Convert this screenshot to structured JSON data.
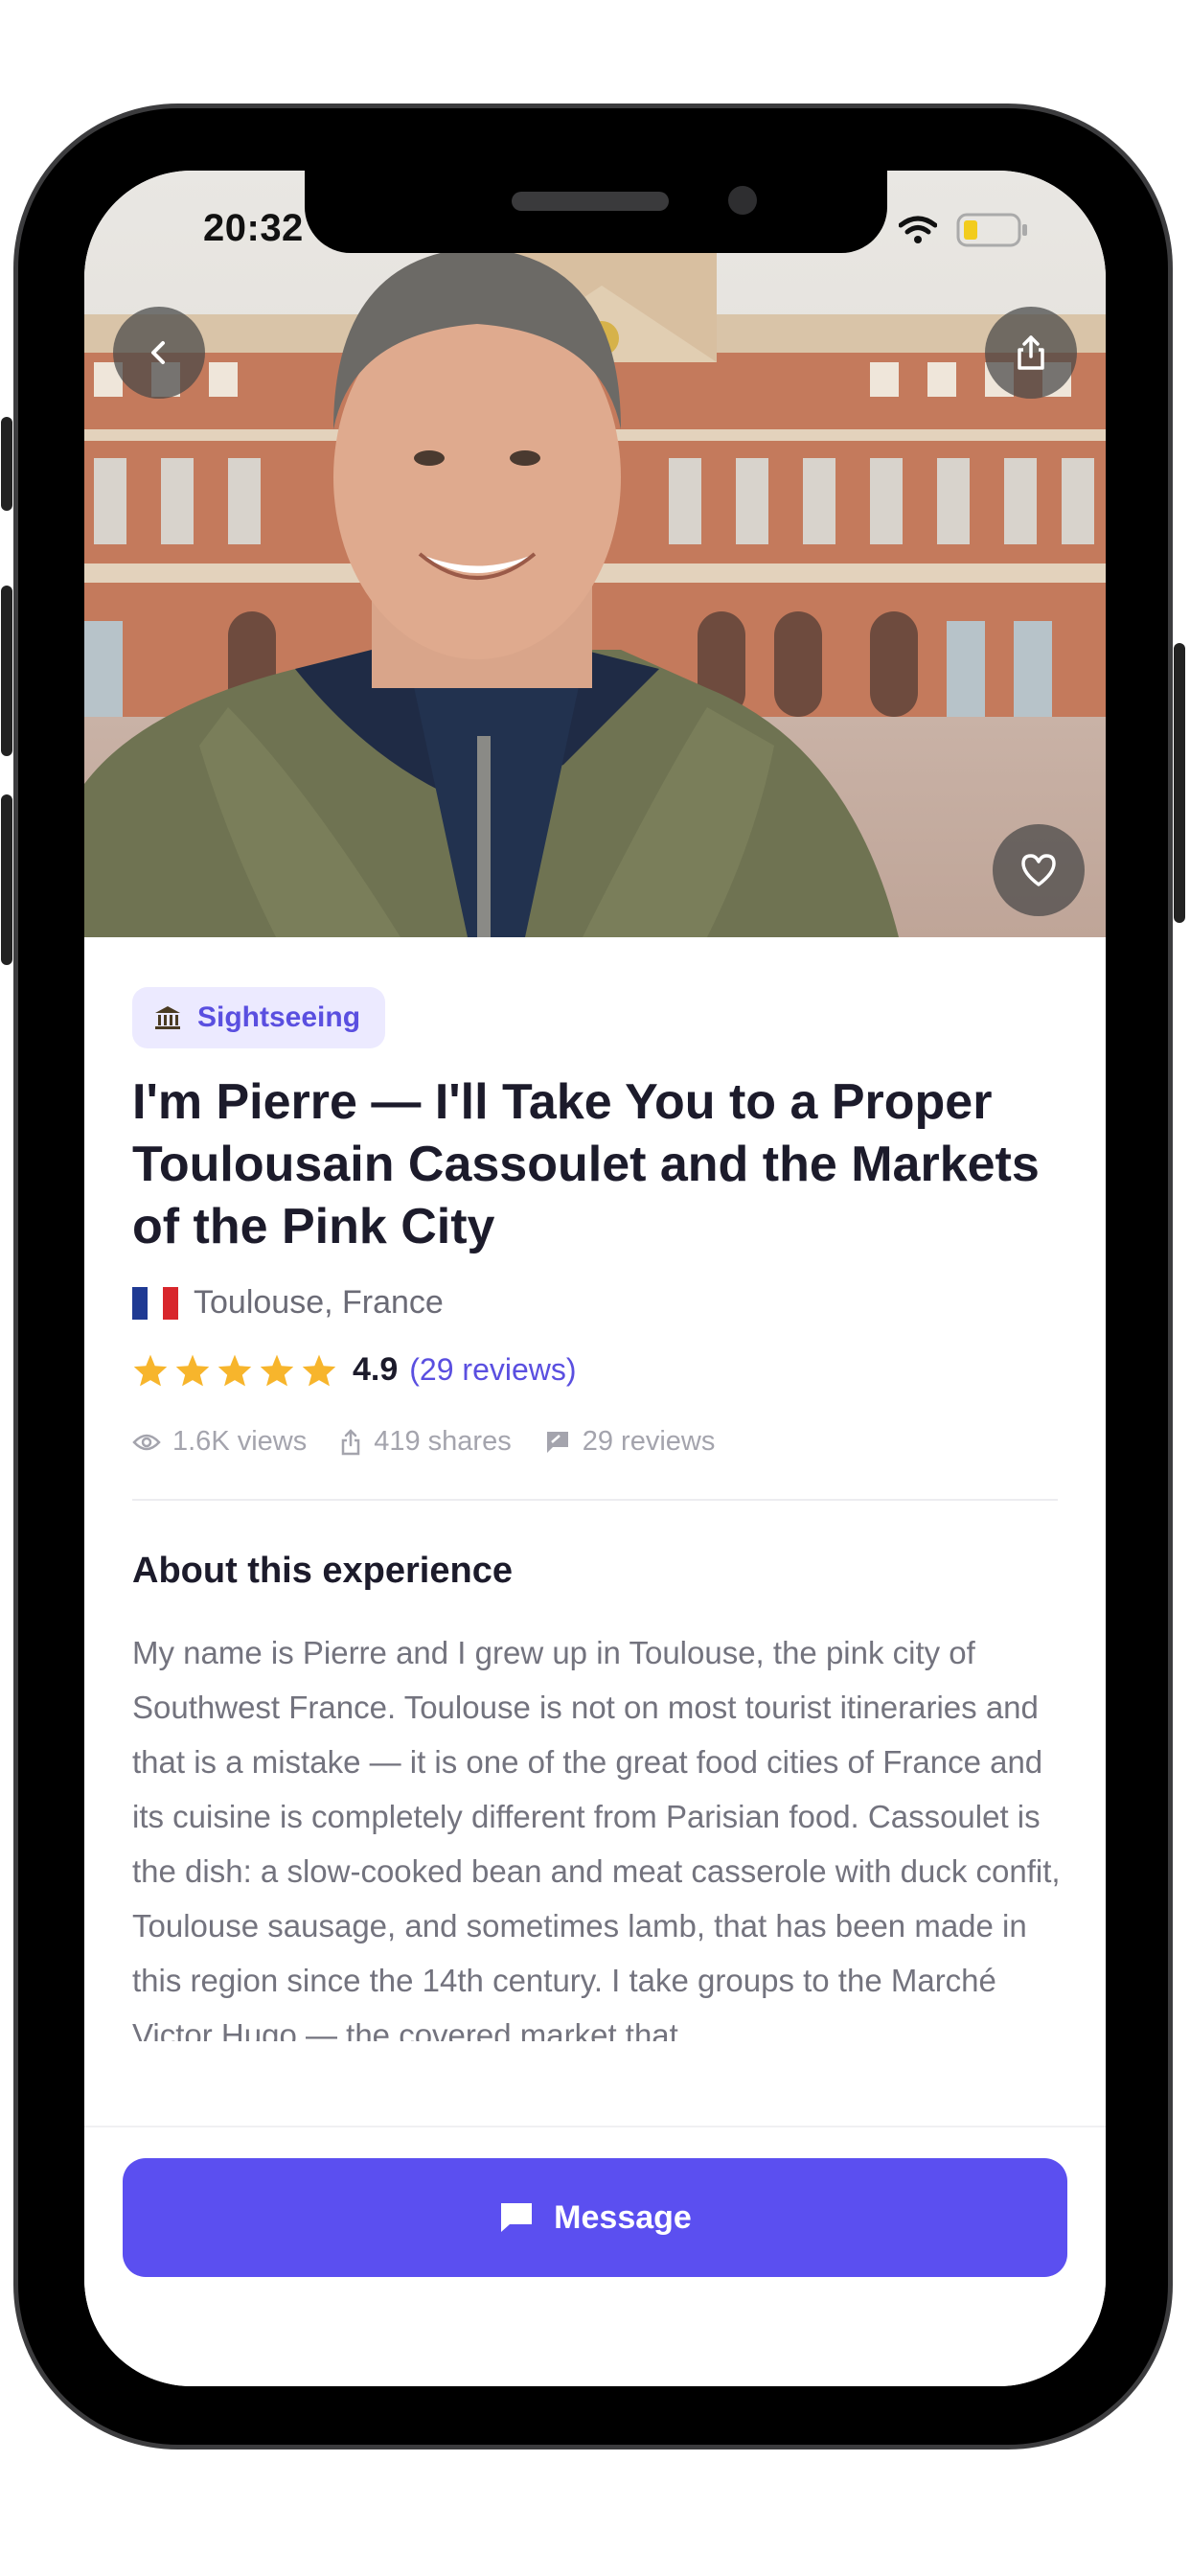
{
  "status_bar": {
    "time": "20:32"
  },
  "hero": {
    "back_icon": "chevron-left-icon",
    "share_icon": "share-icon",
    "favorite_icon": "heart-icon"
  },
  "category": {
    "icon": "museum-icon",
    "label": "Sightseeing"
  },
  "title": "I'm Pierre — I'll Take You to a Proper Toulousain Cassoulet and the Markets of the Pink City",
  "location": {
    "flag": "france-flag-icon",
    "text": "Toulouse, France"
  },
  "rating": {
    "stars": 5,
    "value": "4.9",
    "reviews_label": "(29 reviews)"
  },
  "stats": {
    "views": "1.6K views",
    "shares": "419 shares",
    "reviews": "29 reviews"
  },
  "about": {
    "heading": "About this experience",
    "text": "My name is Pierre and I grew up in Toulouse, the pink city of Southwest France. Toulouse is not on most tourist itineraries and that is a mistake — it is one of the great food cities of France and its cuisine is completely different from Parisian food. Cassoulet is the dish: a slow-cooked bean and meat casserole with duck confit, Toulouse sausage, and sometimes lamb, that has been made in this region since the 14th century. I take groups to the Marché Victor Hugo — the covered market that"
  },
  "cta": {
    "icon": "chat-bubble-icon",
    "label": "Message"
  },
  "colors": {
    "accent": "#5b4ff0",
    "star": "#f7b52c",
    "category_bg": "#eceaff"
  }
}
